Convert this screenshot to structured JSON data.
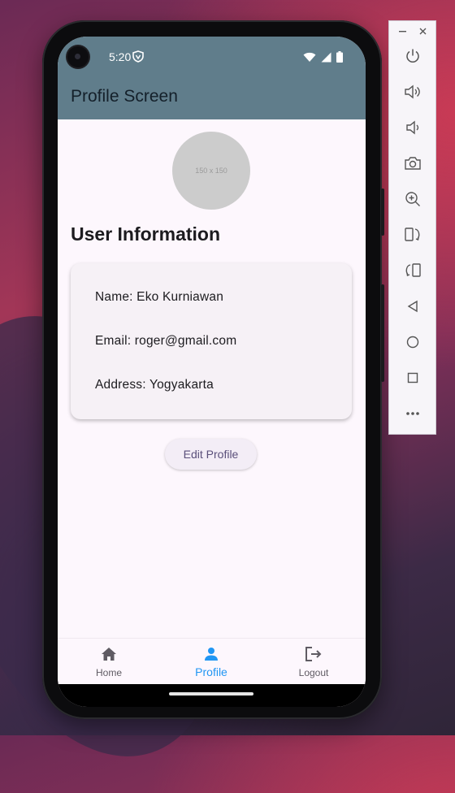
{
  "status_bar": {
    "time": "5:20"
  },
  "app_bar": {
    "title": "Profile Screen"
  },
  "avatar": {
    "placeholder_text": "150 x 150"
  },
  "section": {
    "heading": "User Information"
  },
  "user_info": {
    "name": "Name: Eko Kurniawan",
    "email": "Email: roger@gmail.com",
    "address": "Address: Yogyakarta"
  },
  "actions": {
    "edit_profile_label": "Edit Profile"
  },
  "bottom_nav": {
    "items": [
      {
        "label": "Home",
        "icon": "home-icon",
        "active": false
      },
      {
        "label": "Profile",
        "icon": "person-icon",
        "active": true
      },
      {
        "label": "Logout",
        "icon": "logout-icon",
        "active": false
      }
    ]
  },
  "emulator_panel": {
    "window_controls": [
      "minimize-icon",
      "close-icon"
    ],
    "tools": [
      "power-icon",
      "volume-up-icon",
      "volume-down-icon",
      "camera-icon",
      "zoom-in-icon",
      "rotate-left-icon",
      "rotate-right-icon",
      "back-icon",
      "home-circle-icon",
      "overview-icon",
      "more-icon"
    ]
  },
  "colors": {
    "app_bar": "#607d8b",
    "background": "#fdf7fd",
    "active_nav": "#2196f3",
    "inactive_nav": "#5f5b63"
  }
}
